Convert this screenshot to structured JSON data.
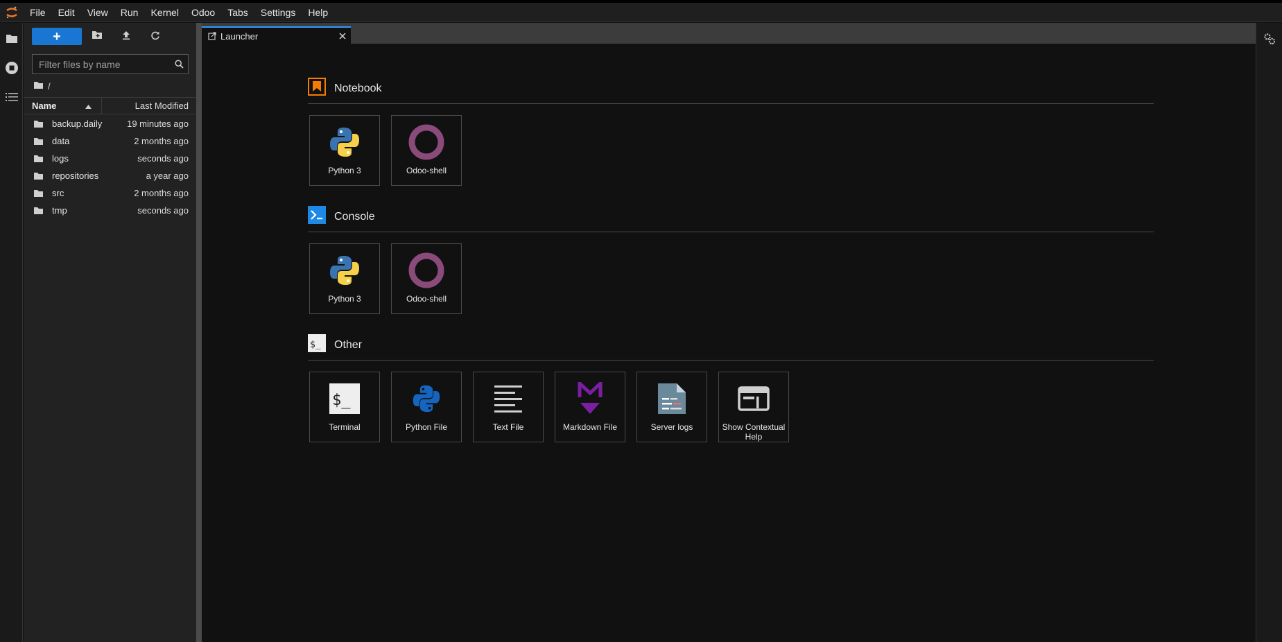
{
  "menubar": {
    "items": [
      "File",
      "Edit",
      "View",
      "Run",
      "Kernel",
      "Odoo",
      "Tabs",
      "Settings",
      "Help"
    ]
  },
  "filebrowser": {
    "new_label": "+",
    "filter_placeholder": "Filter files by name",
    "breadcrumb": "/",
    "columns": {
      "name": "Name",
      "modified": "Last Modified"
    },
    "files": [
      {
        "name": "backup.daily",
        "modified": "19 minutes ago"
      },
      {
        "name": "data",
        "modified": "2 months ago"
      },
      {
        "name": "logs",
        "modified": "seconds ago"
      },
      {
        "name": "repositories",
        "modified": "a year ago"
      },
      {
        "name": "src",
        "modified": "2 months ago"
      },
      {
        "name": "tmp",
        "modified": "seconds ago"
      }
    ]
  },
  "tabs": [
    {
      "label": "Launcher"
    }
  ],
  "launcher": {
    "notebook": {
      "title": "Notebook",
      "items": [
        {
          "label": "Python 3"
        },
        {
          "label": "Odoo-shell"
        }
      ]
    },
    "console": {
      "title": "Console",
      "items": [
        {
          "label": "Python 3"
        },
        {
          "label": "Odoo-shell"
        }
      ]
    },
    "other": {
      "title": "Other",
      "items": [
        {
          "label": "Terminal"
        },
        {
          "label": "Python File"
        },
        {
          "label": "Text File"
        },
        {
          "label": "Markdown File"
        },
        {
          "label": "Server logs"
        },
        {
          "label": "Show Contextual Help"
        }
      ]
    }
  },
  "colors": {
    "accent": "#1976d2",
    "tab_accent": "#2f9bff",
    "notebook_icon": "#f57c00",
    "console_icon": "#1e88e5",
    "odoo": "#8a4a7a",
    "markdown": "#7b1fa2"
  },
  "icons": {
    "logo": "jupyter-logo",
    "files": "folder-icon",
    "running": "stop-circle-icon",
    "toc": "list-icon",
    "settings": "gears-icon"
  }
}
